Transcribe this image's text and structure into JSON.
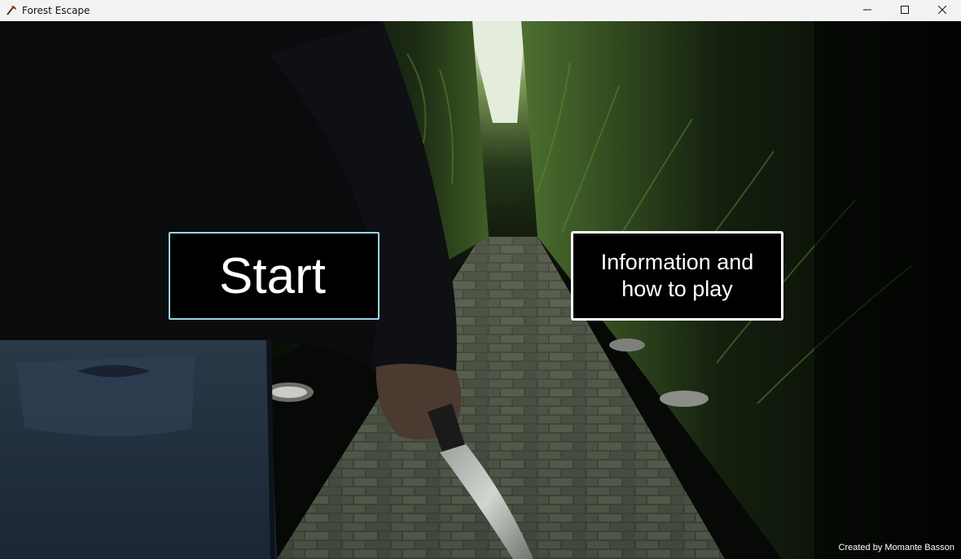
{
  "window": {
    "title": "Forest Escape",
    "icon": "axe-icon",
    "controls": [
      "minimize-icon",
      "maximize-icon",
      "close-icon"
    ]
  },
  "menu": {
    "start_label": "Start",
    "info_label": "Information and how to play"
  },
  "footer": {
    "credit": "Created by Momante Basson"
  },
  "colors": {
    "titlebar": "#f3f3f3",
    "button_bg": "#000000",
    "start_border": "#9ad4ee",
    "info_border": "#ffffff",
    "text": "#ffffff"
  }
}
